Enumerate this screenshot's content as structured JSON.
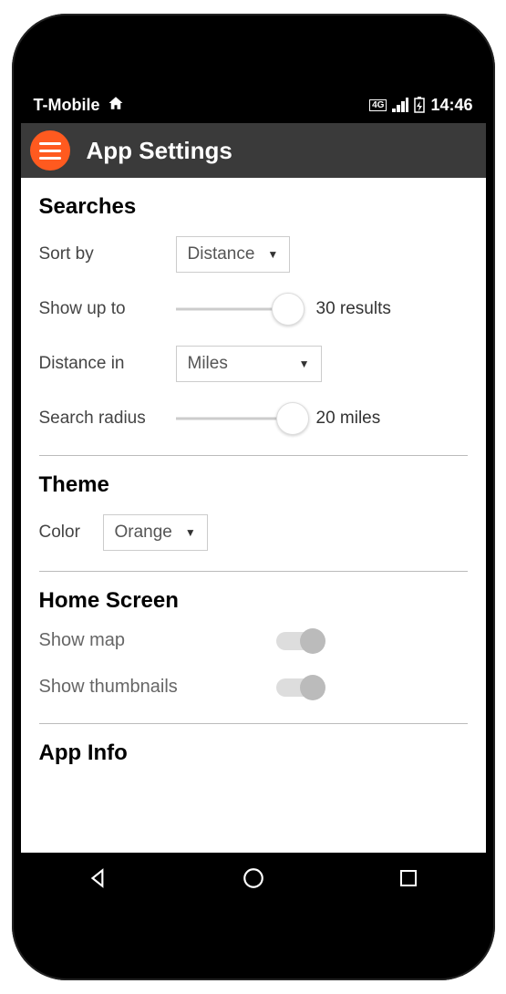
{
  "statusbar": {
    "carrier": "T-Mobile",
    "network_badge": "4G LTE",
    "time": "14:46"
  },
  "appbar": {
    "title": "App Settings"
  },
  "sections": {
    "searches": {
      "title": "Searches",
      "sort_by_label": "Sort by",
      "sort_by_value": "Distance",
      "show_up_to_label": "Show up to",
      "show_up_to_value": "30 results",
      "distance_in_label": "Distance in",
      "distance_in_value": "Miles",
      "search_radius_label": "Search radius",
      "search_radius_value": "20 miles"
    },
    "theme": {
      "title": "Theme",
      "color_label": "Color",
      "color_value": "Orange"
    },
    "home_screen": {
      "title": "Home Screen",
      "show_map_label": "Show map",
      "show_thumbnails_label": "Show thumbnails"
    },
    "app_info": {
      "title": "App Info"
    }
  }
}
